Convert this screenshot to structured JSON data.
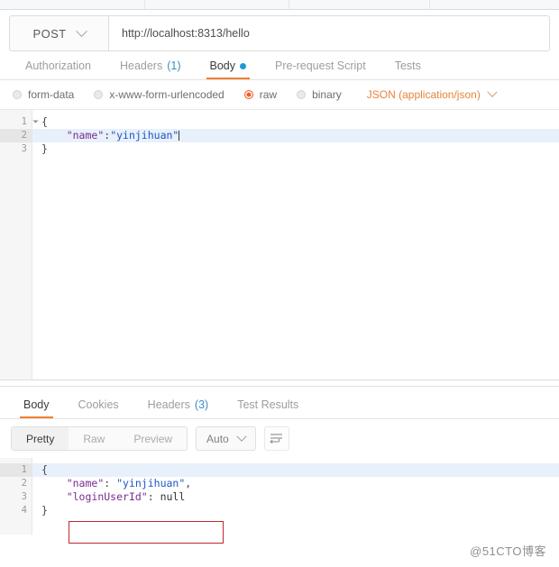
{
  "request": {
    "method": "POST",
    "url": "http://localhost:8313/hello",
    "tabs": [
      {
        "label": "Authorization",
        "count": "",
        "dot": false,
        "active": false
      },
      {
        "label": "Headers",
        "count": "(1)",
        "dot": false,
        "active": false
      },
      {
        "label": "Body",
        "count": "",
        "dot": true,
        "active": true
      },
      {
        "label": "Pre-request Script",
        "count": "",
        "dot": false,
        "active": false
      },
      {
        "label": "Tests",
        "count": "",
        "dot": false,
        "active": false
      }
    ],
    "body_modes": [
      {
        "label": "form-data",
        "selected": false
      },
      {
        "label": "x-www-form-urlencoded",
        "selected": false
      },
      {
        "label": "raw",
        "selected": true
      },
      {
        "label": "binary",
        "selected": false
      }
    ],
    "content_type": "JSON (application/json)",
    "editor": {
      "line_numbers": [
        "1",
        "2",
        "3"
      ],
      "lines": [
        {
          "punc_open": "{"
        },
        {
          "key": "\"name\"",
          "colon": ":",
          "value": "\"yinjihuan\""
        },
        {
          "punc_close": "}"
        }
      ]
    }
  },
  "response": {
    "tabs": [
      {
        "label": "Body",
        "count": "",
        "active": true
      },
      {
        "label": "Cookies",
        "count": "",
        "active": false
      },
      {
        "label": "Headers",
        "count": "(3)",
        "active": false
      },
      {
        "label": "Test Results",
        "count": "",
        "active": false
      }
    ],
    "view_modes": [
      {
        "label": "Pretty",
        "active": true
      },
      {
        "label": "Raw",
        "active": false
      },
      {
        "label": "Preview",
        "active": false
      }
    ],
    "format_select": "Auto",
    "wrap_icon": "wrap-lines-icon",
    "editor": {
      "line_numbers": [
        "1",
        "2",
        "3",
        "4"
      ],
      "lines": [
        {
          "punc_open": "{"
        },
        {
          "key": "\"name\"",
          "colon": ": ",
          "value": "\"yinjihuan\"",
          "comma": ","
        },
        {
          "key": "\"loginUserId\"",
          "colon": ": ",
          "value": "null"
        },
        {
          "punc_close": "}"
        }
      ]
    }
  },
  "annotation": {
    "box_color": "#c0282d",
    "target_text": "\"loginUserId\": null"
  },
  "watermark": "@51CTO博客",
  "colors": {
    "accent_orange": "#ef7f2e",
    "radio_selected": "#ef5b25",
    "link_blue": "#3c8dc4",
    "dot_blue": "#2196d6",
    "annot_red": "#c0282d"
  }
}
